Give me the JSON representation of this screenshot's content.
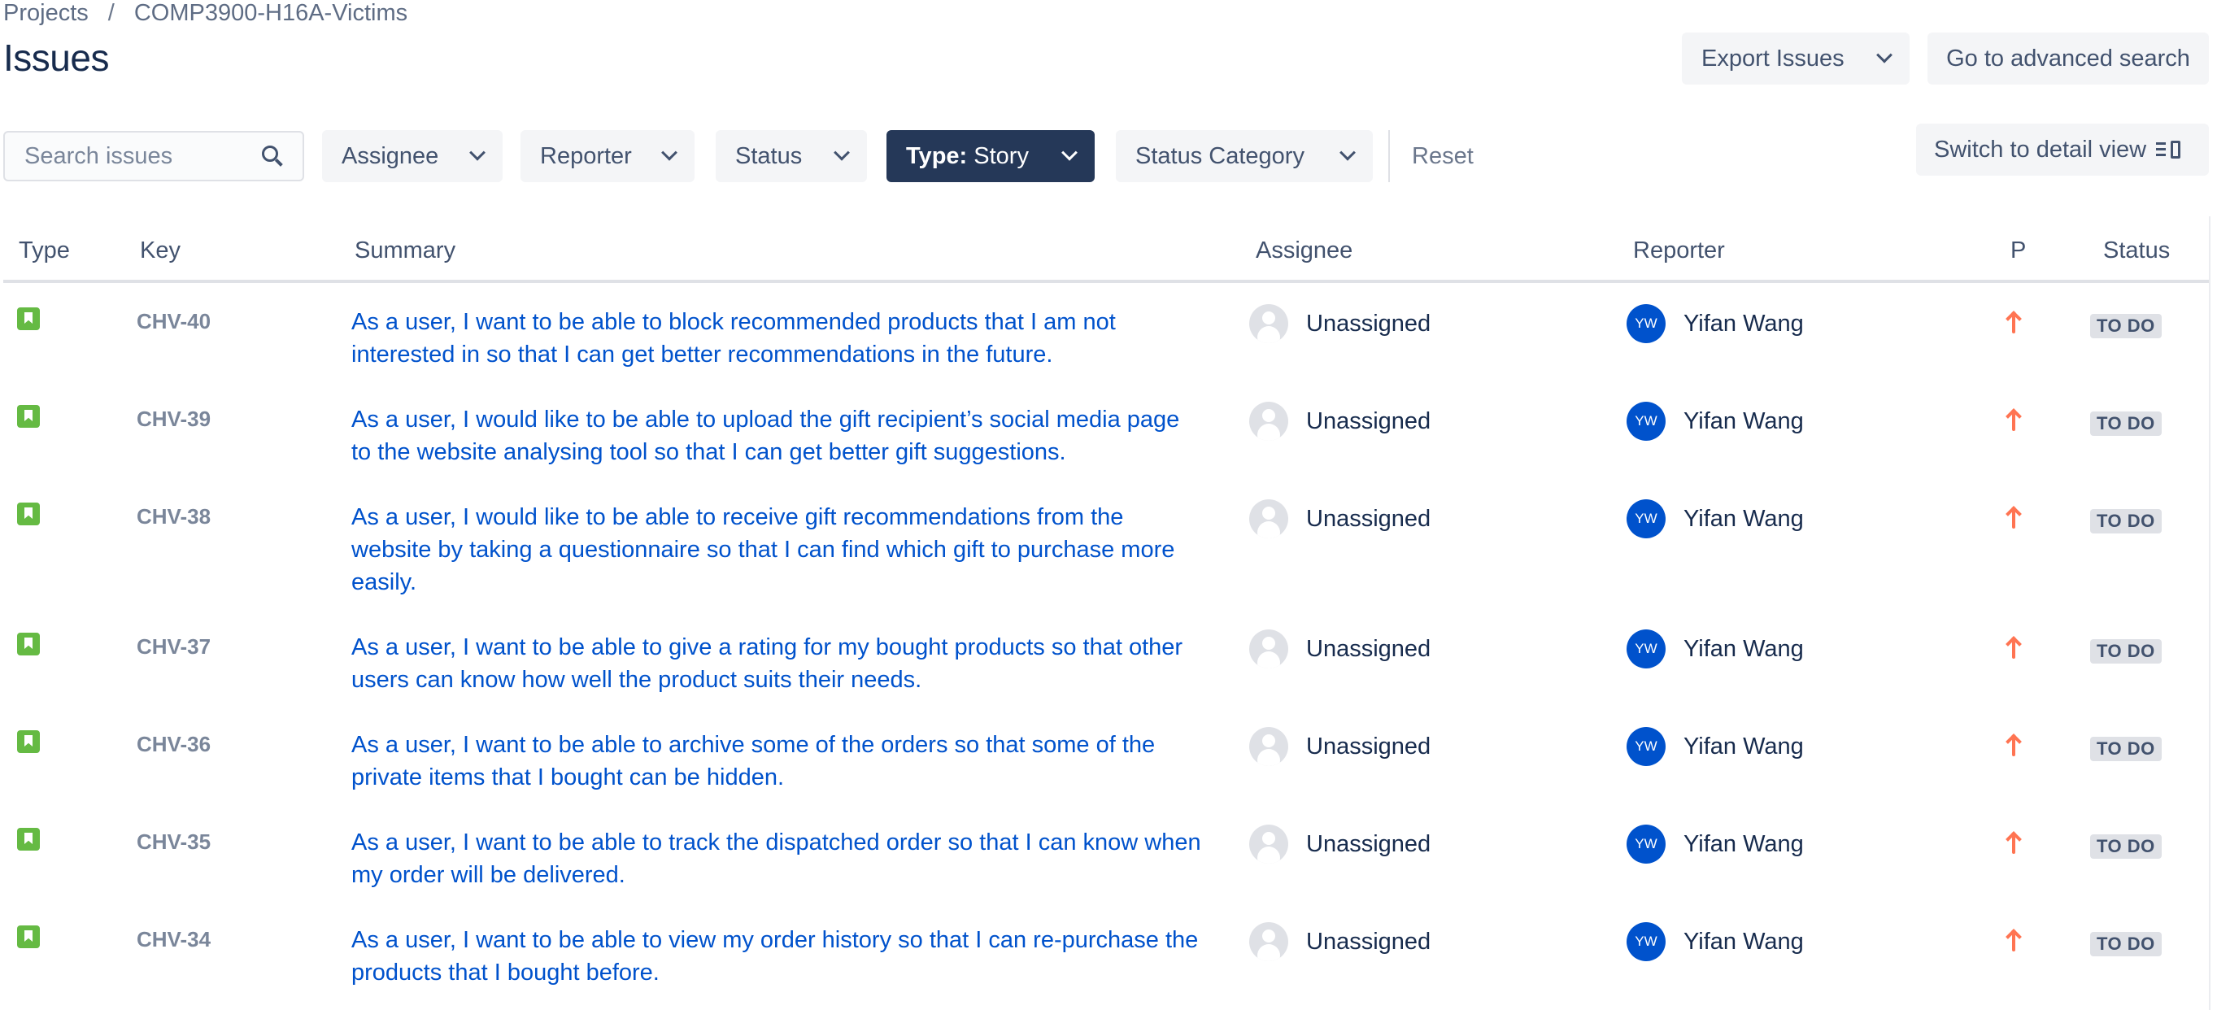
{
  "breadcrumb": {
    "projects": "Projects",
    "separator": "/",
    "project": "COMP3900-H16A-Victims"
  },
  "page_title": "Issues",
  "actions": {
    "export": "Export Issues",
    "advanced_search": "Go to advanced search",
    "detail_view": "Switch to detail view"
  },
  "search": {
    "placeholder": "Search issues",
    "value": ""
  },
  "filters": {
    "assignee": "Assignee",
    "reporter": "Reporter",
    "status": "Status",
    "type_label": "Type:",
    "type_value": "Story",
    "status_category": "Status Category",
    "reset": "Reset"
  },
  "columns": {
    "type": "Type",
    "key": "Key",
    "summary": "Summary",
    "assignee": "Assignee",
    "reporter": "Reporter",
    "priority": "P",
    "status": "Status"
  },
  "issues": [
    {
      "type_icon": "story-icon",
      "key": "CHV-40",
      "summary": "As a user, I want to be able to block recommended products that I am not interested in so that I can get better recommendations in the future.",
      "assignee": "Unassigned",
      "reporter": "Yifan Wang",
      "reporter_initials": "YW",
      "priority_icon": "priority-high-icon",
      "status": "TO DO"
    },
    {
      "type_icon": "story-icon",
      "key": "CHV-39",
      "summary": "As a user, I would like to be able to upload the gift recipient’s social media page to the website analysing tool so that I can get better gift suggestions.",
      "assignee": "Unassigned",
      "reporter": "Yifan Wang",
      "reporter_initials": "YW",
      "priority_icon": "priority-high-icon",
      "status": "TO DO"
    },
    {
      "type_icon": "story-icon",
      "key": "CHV-38",
      "summary": "As a user, I would like to be able to receive gift recommendations from the website by taking a questionnaire so that I can find which gift to purchase more easily.",
      "assignee": "Unassigned",
      "reporter": "Yifan Wang",
      "reporter_initials": "YW",
      "priority_icon": "priority-high-icon",
      "status": "TO DO"
    },
    {
      "type_icon": "story-icon",
      "key": "CHV-37",
      "summary": "As a user, I want to be able to give a rating for my bought products so that other users can know how well the product suits their needs.",
      "assignee": "Unassigned",
      "reporter": "Yifan Wang",
      "reporter_initials": "YW",
      "priority_icon": "priority-high-icon",
      "status": "TO DO"
    },
    {
      "type_icon": "story-icon",
      "key": "CHV-36",
      "summary": "As a user, I want to be able to archive some of the orders so that some of the private items that I bought can be hidden.",
      "assignee": "Unassigned",
      "reporter": "Yifan Wang",
      "reporter_initials": "YW",
      "priority_icon": "priority-high-icon",
      "status": "TO DO"
    },
    {
      "type_icon": "story-icon",
      "key": "CHV-35",
      "summary": "As a user, I want to be able to track the dispatched order so that I can know when my order will be delivered.",
      "assignee": "Unassigned",
      "reporter": "Yifan Wang",
      "reporter_initials": "YW",
      "priority_icon": "priority-high-icon",
      "status": "TO DO"
    },
    {
      "type_icon": "story-icon",
      "key": "CHV-34",
      "summary": "As a user, I want to be able to view my order history so that I can re-purchase the products that I bought before.",
      "assignee": "Unassigned",
      "reporter": "Yifan Wang",
      "reporter_initials": "YW",
      "priority_icon": "priority-high-icon",
      "status": "TO DO"
    }
  ],
  "colors": {
    "link": "#0052cc",
    "story": "#65ba43",
    "priority_high": "#ff7452",
    "active_filter": "#253858"
  }
}
